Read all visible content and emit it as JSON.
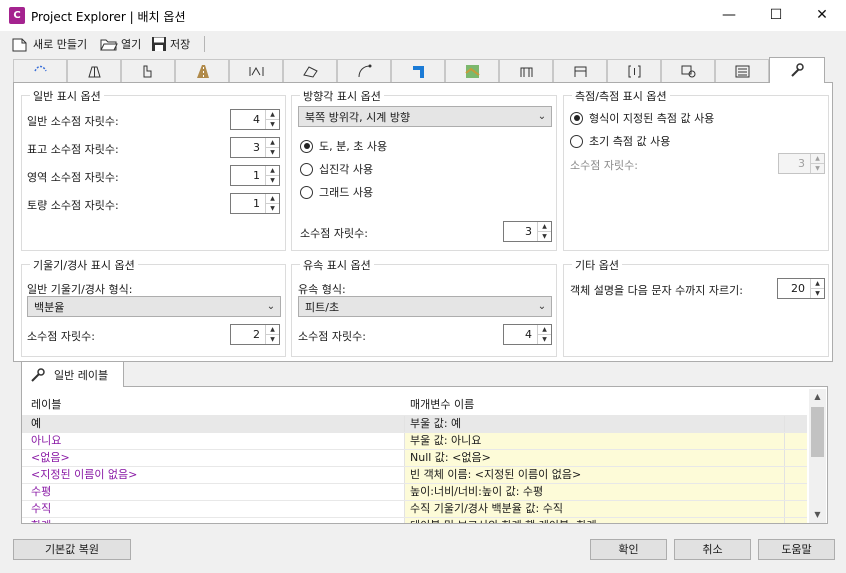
{
  "window": {
    "app_icon_letter": "C",
    "title": "Project Explorer | 배치 옵션",
    "minimize": "—",
    "maximize": "☐",
    "close": "✕"
  },
  "toolbar": {
    "new_label": "새로 만들기",
    "open_label": "열기",
    "save_label": "저장"
  },
  "tabs": [
    {
      "icon": "alignment-icon"
    },
    {
      "icon": "corridor-icon"
    },
    {
      "icon": "profile-icon"
    },
    {
      "icon": "road-icon"
    },
    {
      "icon": "section-icon"
    },
    {
      "icon": "surface-icon"
    },
    {
      "icon": "curve-icon"
    },
    {
      "icon": "pipe-icon"
    },
    {
      "icon": "map-icon"
    },
    {
      "icon": "structure-icon"
    },
    {
      "icon": "structure2-icon"
    },
    {
      "icon": "bracket-icon"
    },
    {
      "icon": "search-shape-icon"
    },
    {
      "icon": "report-icon"
    },
    {
      "icon": "wrench-icon",
      "active": true
    }
  ],
  "general": {
    "title": "일반 표시 옵션",
    "rows": [
      {
        "label": "일반 소수점 자릿수:",
        "value": "4"
      },
      {
        "label": "표고 소수점 자릿수:",
        "value": "3"
      },
      {
        "label": "영역 소수점 자릿수:",
        "value": "1"
      },
      {
        "label": "토량 소수점 자릿수:",
        "value": "1"
      }
    ]
  },
  "bearing": {
    "title": "방향각 표시 옵션",
    "combo": "북쪽 방위각, 시계 방향",
    "radios": [
      {
        "label": "도, 분, 초 사용",
        "checked": true
      },
      {
        "label": "십진각 사용",
        "checked": false
      },
      {
        "label": "그래드 사용",
        "checked": false
      }
    ],
    "precision_label": "소수점 자릿수:",
    "precision_value": "3"
  },
  "station": {
    "title": "측점/측점 표시 옵션",
    "radios": [
      {
        "label": "형식이 지정된 측점 값 사용",
        "checked": true
      },
      {
        "label": "초기 측점 값 사용",
        "checked": false
      }
    ],
    "precision_label": "소수점 자릿수:",
    "precision_value": "3"
  },
  "slope": {
    "title": "기울기/경사 표시 옵션",
    "format_label": "일반 기울기/경사 형식:",
    "combo": "백분율",
    "precision_label": "소수점 자릿수:",
    "precision_value": "2"
  },
  "velocity": {
    "title": "유속 표시 옵션",
    "format_label": "유속 형식:",
    "combo": "피트/초",
    "precision_label": "소수점 자릿수:",
    "precision_value": "4"
  },
  "other": {
    "title": "기타 옵션",
    "truncate_label": "객체 설명을 다음 문자 수까지 자르기:",
    "truncate_value": "20"
  },
  "labels_tab": {
    "title": "일반 레이블"
  },
  "labels_grid": {
    "col_label": "레이블",
    "col_param": "매개변수 이름",
    "rows": [
      {
        "label": "예",
        "param": "부울 값: 예",
        "selected": true
      },
      {
        "label": "아니요",
        "param": "부울 값: 아니요"
      },
      {
        "label": "<없음>",
        "param": "Null 값: <없음>"
      },
      {
        "label": "<지정된 이름이 없음>",
        "param": "빈 객체 이름: <지정된 이름이 없음>"
      },
      {
        "label": "수평",
        "param": "높이:너비/너비:높이 값: 수평"
      },
      {
        "label": "수직",
        "param": "수직 기울기/경사 백분율 값: 수직"
      },
      {
        "label": "한계",
        "param": "테이블 및 보고서의 한계 행 레이블: 한계"
      }
    ]
  },
  "buttons": {
    "reset": "기본값 복원",
    "ok": "확인",
    "cancel": "취소",
    "help": "도움말"
  }
}
